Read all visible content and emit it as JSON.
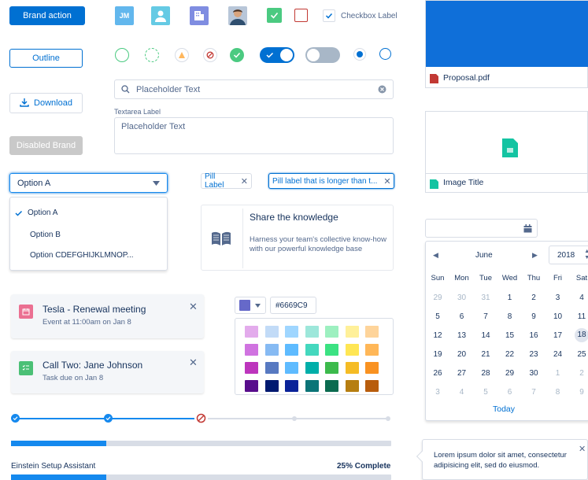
{
  "buttons": {
    "brand": "Brand action",
    "outline": "Outline",
    "download": "Download",
    "disabled": "Disabled Brand"
  },
  "avatars": {
    "initials": "JM"
  },
  "checkbox": {
    "label": "Checkbox Label"
  },
  "search": {
    "placeholder": "Placeholder Text"
  },
  "textarea": {
    "label": "Textarea Label",
    "placeholder": "Placeholder Text"
  },
  "combobox": {
    "selected": "Option A",
    "options": [
      "Option A",
      "Option B",
      "Option CDEFGHIJKLMNOP..."
    ]
  },
  "pills": [
    "Pill Label",
    "Pill label that is longer than t..."
  ],
  "knowledge": {
    "title": "Share the knowledge",
    "body": "Harness your team's collective know-how with our powerful knowledge base"
  },
  "notifications": [
    {
      "title": "Tesla - Renewal meeting",
      "subtitle": "Event at 11:00am on Jan 8",
      "icon_color": "#eb7092"
    },
    {
      "title": "Call Two: Jane Johnson",
      "subtitle": "Task due on Jan 8",
      "icon_color": "#4bc076"
    }
  ],
  "color_picker": {
    "hex": "#6669C9",
    "selected_color": "#6669c9",
    "swatches": [
      [
        "#e3abec",
        "#c2dbf7",
        "#9fd6ff",
        "#9de7da",
        "#9df0c0",
        "#fff099",
        "#fed49a"
      ],
      [
        "#d073e0",
        "#86baf3",
        "#5ebbff",
        "#44d8be",
        "#3be282",
        "#ffe654",
        "#ffb758"
      ],
      [
        "#bd35bd",
        "#5779c1",
        "#5ebbff",
        "#00aea9",
        "#3cba4c",
        "#f5bc25",
        "#f99221"
      ],
      [
        "#580d8c",
        "#001970",
        "#0a2399",
        "#0b7477",
        "#0b6b50",
        "#b67e11",
        "#b85d0d"
      ]
    ]
  },
  "progress": {
    "assistant_label": "Einstein Setup Assistant",
    "assistant_value": "25% Complete",
    "fraction": 0.25
  },
  "files": [
    {
      "name": "Proposal.pdf"
    },
    {
      "name": "Image Title"
    }
  ],
  "calendar": {
    "month": "June",
    "year": "2018",
    "weekdays": [
      "Sun",
      "Mon",
      "Tue",
      "Wed",
      "Thu",
      "Fri",
      "Sat"
    ],
    "weeks": [
      [
        "29",
        "30",
        "31",
        "1",
        "2",
        "3",
        "4"
      ],
      [
        "5",
        "6",
        "7",
        "8",
        "9",
        "10",
        "11"
      ],
      [
        "12",
        "13",
        "14",
        "15",
        "16",
        "17",
        "18"
      ],
      [
        "19",
        "20",
        "21",
        "22",
        "23",
        "24",
        "25"
      ],
      [
        "26",
        "27",
        "28",
        "29",
        "30",
        "1",
        "2"
      ],
      [
        "3",
        "4",
        "5",
        "6",
        "7",
        "8",
        "9"
      ]
    ],
    "today_label": "Today"
  },
  "popover": {
    "text": "Lorem ipsum dolor sit amet, consectetur adipisicing elit, sed do eiusmod."
  },
  "colors": {
    "brand": "#0070d2",
    "success": "#04844b",
    "error": "#c23934",
    "warning": "#ffb75d"
  }
}
